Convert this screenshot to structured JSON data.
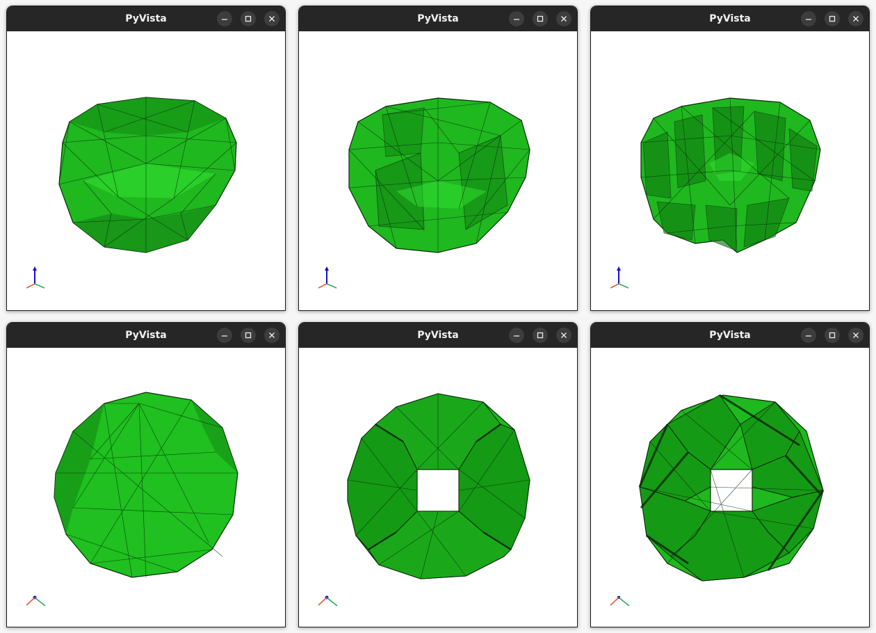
{
  "windows": [
    {
      "title": "PyVista",
      "controls": {
        "minimize": "minimize-icon",
        "maximize": "maximize-icon",
        "close": "close-icon"
      }
    },
    {
      "title": "PyVista",
      "controls": {
        "minimize": "minimize-icon",
        "maximize": "maximize-icon",
        "close": "close-icon"
      }
    },
    {
      "title": "PyVista",
      "controls": {
        "minimize": "minimize-icon",
        "maximize": "maximize-icon",
        "close": "close-icon"
      }
    },
    {
      "title": "PyVista",
      "controls": {
        "minimize": "minimize-icon",
        "maximize": "maximize-icon",
        "close": "close-icon"
      }
    },
    {
      "title": "PyVista",
      "controls": {
        "minimize": "minimize-icon",
        "maximize": "maximize-icon",
        "close": "close-icon"
      }
    },
    {
      "title": "PyVista",
      "controls": {
        "minimize": "minimize-icon",
        "maximize": "maximize-icon",
        "close": "close-icon"
      }
    }
  ],
  "colors": {
    "mesh_fill": "#1fb81f",
    "mesh_dark": "#128a12",
    "mesh_edge": "#0a2a0a",
    "titlebar": "#262626",
    "axis_x": "#e05a3a",
    "axis_y": "#2ea860",
    "axis_z": "#1010d0"
  }
}
